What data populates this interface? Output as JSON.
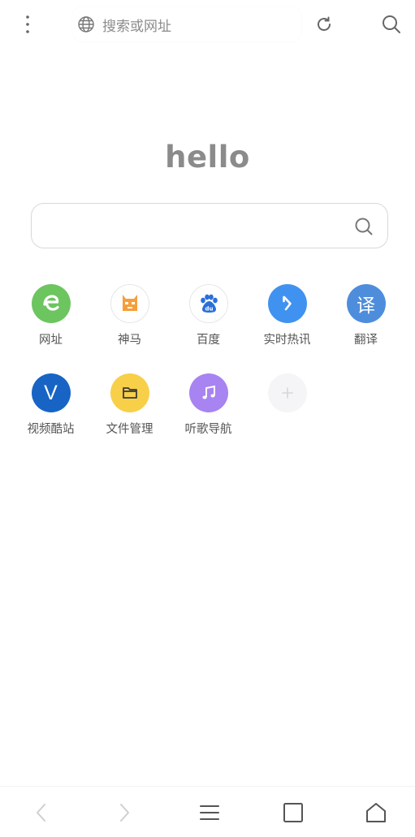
{
  "topbar": {
    "address_placeholder": "搜索或网址",
    "icons": {
      "menu": "more-vertical-icon",
      "globe": "globe-icon",
      "refresh": "refresh-icon",
      "search": "search-icon"
    }
  },
  "main": {
    "greeting": "hello",
    "search_placeholder": ""
  },
  "shortcuts": [
    {
      "label": "网址",
      "icon": "e-icon",
      "color": "#6cc55f"
    },
    {
      "label": "神马",
      "icon": "shenma-icon",
      "color": "#f59f3a"
    },
    {
      "label": "百度",
      "icon": "baidu-paw-icon",
      "color": "#2a6fdb"
    },
    {
      "label": "实时热讯",
      "icon": "arrow-cursor-icon",
      "color": "#3f92f0"
    },
    {
      "label": "翻译",
      "icon": "translate-icon",
      "glyph": "译",
      "color": "#4e8ddc"
    },
    {
      "label": "视频酷站",
      "icon": "v-icon",
      "glyph": "V",
      "color": "#1764c4"
    },
    {
      "label": "文件管理",
      "icon": "folder-icon",
      "color": "#f8cf48"
    },
    {
      "label": "听歌导航",
      "icon": "music-note-icon",
      "color": "#a883f2"
    },
    {
      "label": "",
      "icon": "plus-icon",
      "color": "#f5f5f7"
    }
  ],
  "bottom_nav": {
    "icons": [
      "back-icon",
      "forward-icon",
      "menu-lines-icon",
      "tabs-square-icon",
      "home-icon"
    ]
  }
}
